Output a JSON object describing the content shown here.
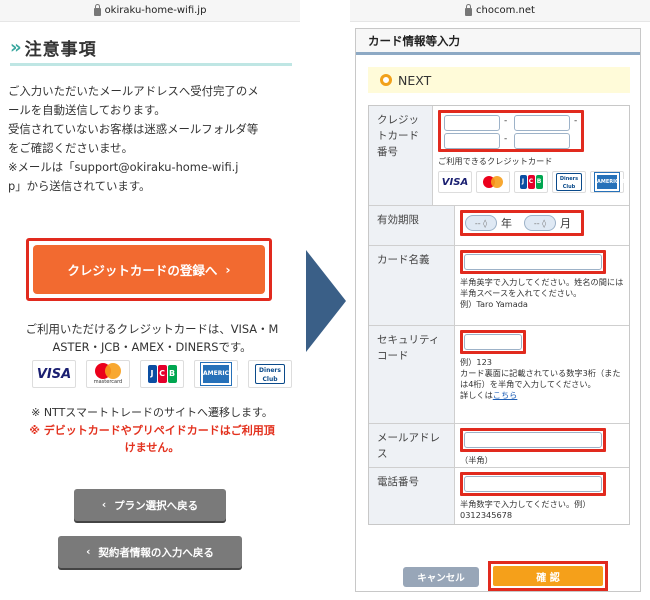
{
  "left": {
    "url": "okiraku-home-wifi.jp",
    "heading_chevron": "»",
    "heading": "注意事項",
    "notice_lines": [
      "ご入力いただいたメールアドレスへ受付完了のメ",
      "ールを自動送信しております。",
      "受信されていないお客様は迷惑メールフォルダ等",
      "をご確認くださいませ。",
      "※メールは「support@okiraku-home-wifi.j",
      "p」から送信されています。"
    ],
    "cc_button": "クレジットカードの登録へ",
    "cc_button_arrow": "›",
    "usable_lines": [
      "ご利用いただけるクレジットカードは、VISA・M",
      "ASTER・JCB・AMEX・DINERSです。"
    ],
    "logos": {
      "visa": "VISA",
      "mastercard": "mastercard",
      "jcb": [
        "J",
        "C",
        "B"
      ],
      "amex": "AMERICAN EXPRESS",
      "diners": "Diners Club"
    },
    "ntt_note": "※ NTTスマートトレードのサイトへ遷移します。",
    "warning_lines": [
      "※ デビットカードやプリペイドカードはご利用頂",
      "けません。"
    ],
    "back_plan_button": "プラン選択へ戻る",
    "back_contract_button": "契約者情報の入力へ戻る",
    "back_icon": "‹"
  },
  "right": {
    "url": "chocom.net",
    "form_title": "カード情報等入力",
    "next_label": "NEXT",
    "rows": {
      "card_number": {
        "label": "クレジットカード番号",
        "dash": "-",
        "usable_note": "ご利用できるクレジットカード"
      },
      "expiry": {
        "label": "有効期限",
        "select_placeholder": "-- ◊",
        "year": "年",
        "month": "月"
      },
      "card_name": {
        "label": "カード名義",
        "note": "半角英字で入力してください。姓名の間には半角スペースを入れてください。",
        "example": "例）Taro Yamada"
      },
      "security": {
        "label": "セキュリティコード",
        "example": "例）123",
        "note": "カード裏面に記載されている数字3桁（または4桁）を半角で入力してください。",
        "detail_prefix": "詳しくは",
        "detail_link": "こちら"
      },
      "mail": {
        "label": "メールアドレス",
        "note": "（半角）"
      },
      "phone": {
        "label": "電話番号",
        "note": "半角数字で入力してください。例）",
        "example": "0312345678"
      }
    },
    "cancel_button": "キャンセル",
    "confirm_button": "確 認"
  },
  "colors": {
    "accent_teal": "#3aa79f",
    "cta_orange": "#f26a30",
    "highlight_red": "#e12a1e",
    "arrow_blue": "#3a5f87",
    "confirm_orange": "#f5a01a"
  },
  "icons": [
    "lock-icon",
    "double-chevron-icon",
    "chevron-right-icon",
    "chevron-left-icon",
    "right-arrow-icon",
    "radio-circle-icon"
  ]
}
